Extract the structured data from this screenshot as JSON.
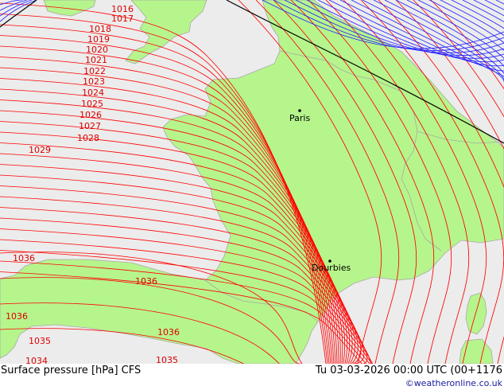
{
  "map": {
    "colors": {
      "sea": "#ececec",
      "land": "#b6f58c",
      "border": "#a8a8a8",
      "isobar": "#ff0000",
      "isobar_label": "#dd0000",
      "front_line": "#000000",
      "low_isobar": "#2424ff"
    },
    "isobar_labels": [
      "1016",
      "1017",
      "1018",
      "1019",
      "1020",
      "1021",
      "1022",
      "1023",
      "1024",
      "1025",
      "1026",
      "1027",
      "1028",
      "1029",
      "1036",
      "1036",
      "1036",
      "1036",
      "1035",
      "1035",
      "1034"
    ],
    "cities": [
      {
        "name": "Paris"
      },
      {
        "name": "Dourbies"
      }
    ]
  },
  "footer": {
    "title": "Surface pressure [hPa] CFS",
    "datetime": "Tu 03-03-2026 00:00 UTC (00+1176",
    "copyright": "©weatheronline.co.uk"
  }
}
